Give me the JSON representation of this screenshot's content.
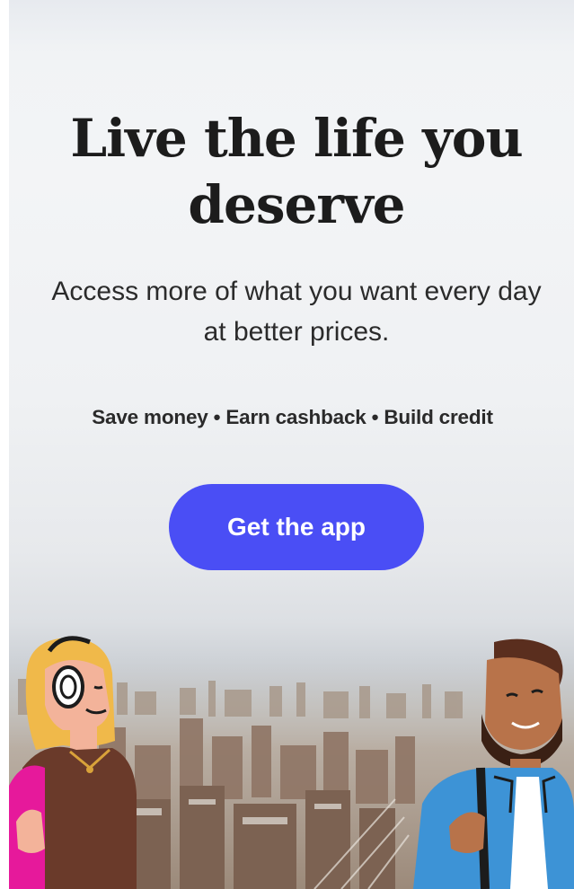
{
  "hero": {
    "headline": "Live the life you deserve",
    "subheadline": "Access more of what you want every day at better prices.",
    "benefits": "Save money • Earn cashback • Build credit",
    "cta_label": "Get the app",
    "colors": {
      "accent": "#4a4ef5",
      "headline": "#1c1c1c",
      "text": "#2b2b2b"
    }
  },
  "illustration": {
    "background": "city-skyline-photo",
    "left_person": "woman-with-headphones",
    "right_person": "bearded-man-in-blue-jacket"
  }
}
